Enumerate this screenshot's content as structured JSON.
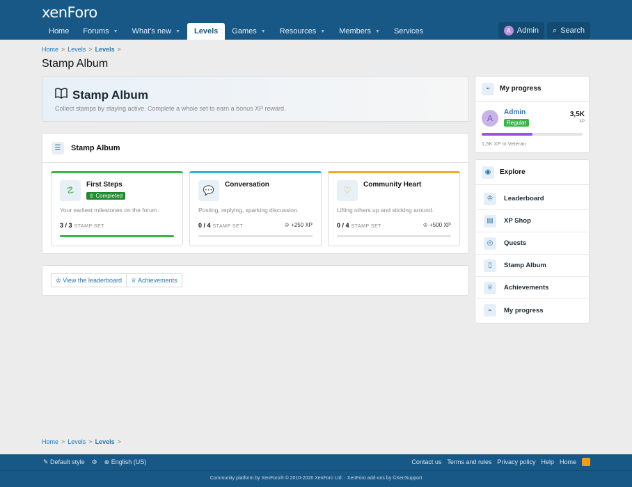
{
  "header": {
    "logo": "xenForo",
    "nav": [
      {
        "label": "Home",
        "caret": false,
        "active": false
      },
      {
        "label": "Forums",
        "caret": true,
        "active": false
      },
      {
        "label": "What's new",
        "caret": true,
        "active": false
      },
      {
        "label": "Levels",
        "caret": false,
        "active": true
      },
      {
        "label": "Games",
        "caret": true,
        "active": false
      },
      {
        "label": "Resources",
        "caret": true,
        "active": false
      },
      {
        "label": "Members",
        "caret": true,
        "active": false
      },
      {
        "label": "Services",
        "caret": false,
        "active": false
      }
    ],
    "user_initial": "A",
    "user_label": "Admin",
    "search_label": "Search"
  },
  "breadcrumb": {
    "home": "Home",
    "levels": "Levels",
    "current": "Levels",
    "sep": ">"
  },
  "page_title": "Stamp Album",
  "hero": {
    "title": "Stamp Album",
    "subtitle": "Collect stamps by staying active. Complete a whole set to earn a bonus XP reward."
  },
  "album": {
    "heading": "Stamp Album",
    "cards": [
      {
        "title": "First Steps",
        "badge": "Completed",
        "desc": "Your earliest milestones on the forum.",
        "count": "3 / 3",
        "count_label": "STAMP SET",
        "reward": "",
        "progress": 1.0,
        "accent": "#3bb54a",
        "icon": "☡"
      },
      {
        "title": "Conversation",
        "badge": "",
        "desc": "Posting, replying, sparking discussion.",
        "count": "0 / 4",
        "count_label": "STAMP SET",
        "reward": "+250 XP",
        "progress": 0,
        "accent": "#2fb0d6",
        "icon": "💬"
      },
      {
        "title": "Community Heart",
        "badge": "",
        "desc": "Lifting others up and sticking around.",
        "count": "0 / 4",
        "count_label": "STAMP SET",
        "reward": "+500 XP",
        "progress": 0,
        "accent": "#f0a830",
        "icon": "♡"
      }
    ]
  },
  "links": {
    "leaderboard": "View the leaderboard",
    "achievements": "Achievements"
  },
  "progress": {
    "heading": "My progress",
    "user_initial": "A",
    "user": "Admin",
    "rank": "Regular",
    "xp": "3,5K",
    "xp_unit": "XP",
    "fill": 0.5,
    "note": "1,5K XP to Veteran"
  },
  "explore": {
    "heading": "Explore",
    "items": [
      {
        "label": "Leaderboard",
        "icon": "trophy-icon",
        "glyph": "♔"
      },
      {
        "label": "XP Shop",
        "icon": "shop-icon",
        "glyph": "▤"
      },
      {
        "label": "Quests",
        "icon": "target-icon",
        "glyph": "◎"
      },
      {
        "label": "Stamp Album",
        "icon": "book-icon",
        "glyph": "▯"
      },
      {
        "label": "Achievements",
        "icon": "medal-icon",
        "glyph": "♕"
      },
      {
        "label": "My progress",
        "icon": "chart-icon",
        "glyph": "⌁"
      }
    ]
  },
  "footer": {
    "style": "Default style",
    "language": "English (US)",
    "links": [
      "Contact us",
      "Terms and rules",
      "Privacy policy",
      "Help",
      "Home"
    ],
    "copyright": "Community platform by XenForo® © 2010-2026 XenForo Ltd. · XenForo add-ons by ©XenSupport"
  }
}
